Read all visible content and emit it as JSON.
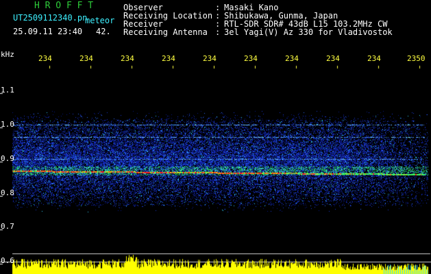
{
  "app": {
    "title": "H R O F F T",
    "file_name": "UT2509112340.pn",
    "mode": "meteor",
    "timestamp": "25.09.11 23:40",
    "count": "42."
  },
  "info": {
    "labels": [
      "Observer",
      "Receiving Location",
      "Receiver",
      "Receiving Antenna"
    ],
    "separator": ":",
    "values": [
      "Masaki Kano",
      "Shibukawa, Gunma, Japan",
      "RTL-SDR SDR# 43dB L15 103.2MHz CW",
      "3el Yagi(V) Az 330 for Vladivostok"
    ]
  },
  "axes": {
    "y_unit": "kHz",
    "y_ticks": [
      "1.1",
      "1.0",
      "0.9",
      "0.8",
      "0.7",
      "0.6"
    ],
    "x_ticks": [
      "234",
      "234",
      "234",
      "234",
      "234",
      "234",
      "234",
      "234",
      "234",
      "2350"
    ]
  },
  "colors": {
    "background": "#000000",
    "title": "#2ecc3a",
    "file_info": "#3df0ff",
    "info_text": "#ffffff",
    "ticks": "#ffff40",
    "noise": "#1c2fd0",
    "echo_line": "#ff2020",
    "amplitude": "#ffff00"
  }
}
